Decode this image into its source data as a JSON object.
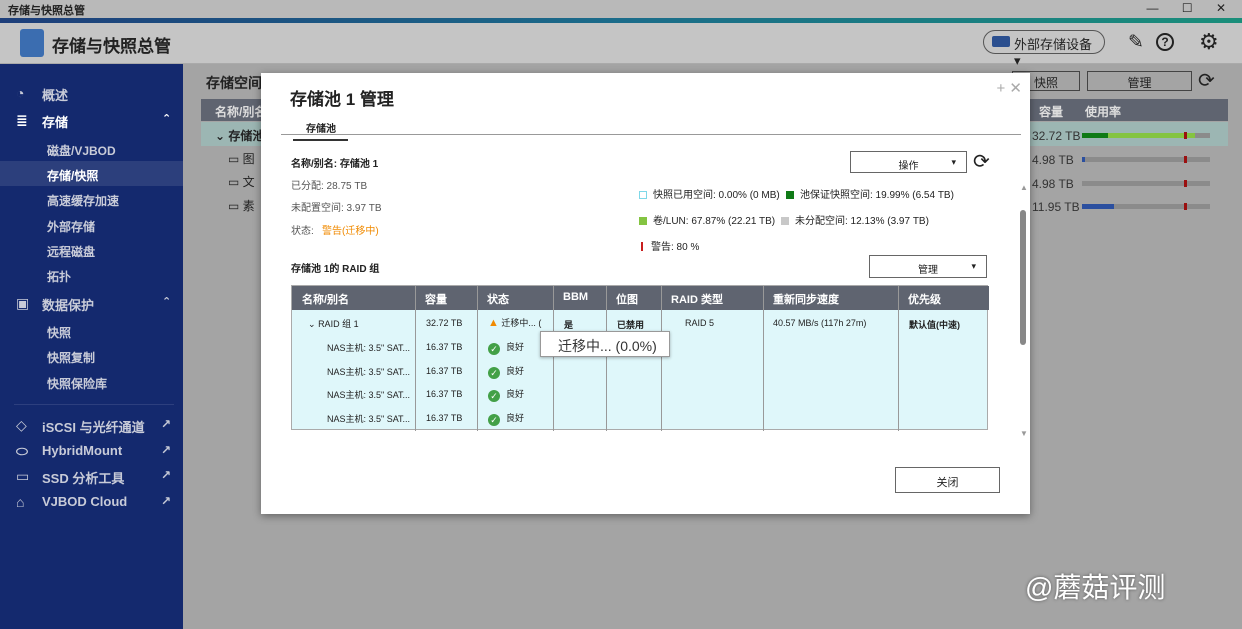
{
  "window": {
    "title": "存储与快照总管",
    "controls": "— ☐ ✕"
  },
  "header": {
    "app_title": "存储与快照总管",
    "external_storage": "外部存储设备",
    "external_caret": "▾",
    "wand_icon": "✎",
    "help_icon": "?",
    "settings_icon": "⚙"
  },
  "sidebar": {
    "overview": "概述",
    "storage": "存储",
    "storage_items": [
      "磁盘/VJBOD",
      "存储/快照",
      "高速缓存加速",
      "外部存储",
      "远程磁盘",
      "拓扑"
    ],
    "data_protection": "数据保护",
    "protection_items": [
      "快照",
      "快照复制",
      "快照保险库"
    ],
    "apps": [
      "iSCSI 与光纤通道",
      "HybridMount",
      "SSD 分析工具",
      "VJBOD Cloud"
    ],
    "collapse_icon": "⌃",
    "external_link_icon": "↗"
  },
  "background": {
    "page_title": "存储空间",
    "col_name": "名称/别名",
    "col_capacity": "容量",
    "col_usage": "使用率",
    "snapshot_btn": "快照",
    "manage_btn": "管理",
    "rows": [
      {
        "name": "存储池",
        "capacity": "32.72 TB",
        "usage_green_dark": 0.2,
        "usage_green": 0.88,
        "warn": 0.8
      },
      {
        "name": "图",
        "capacity": "4.98 TB",
        "usage_blue": 0.02,
        "warn": 0.8
      },
      {
        "name": "文",
        "capacity": "4.98 TB",
        "usage_blue": 0,
        "warn": 0.8
      },
      {
        "name": "素",
        "capacity": "11.95 TB",
        "usage_blue": 0.25,
        "warn": 0.8
      }
    ]
  },
  "modal": {
    "title": "存储池 1 管理",
    "tab": "存储池",
    "name_label": "名称/别名: 存储池 1",
    "allocated": "已分配:  28.75 TB",
    "unallocated": "未配置空间:   3.97 TB",
    "status_label": "状态:",
    "status_value": "警告(迁移中)",
    "action_btn": "操作",
    "legend": {
      "snapshot_used": "快照已用空间: 0.00% (0 MB)",
      "guaranteed": "池保证快照空间: 19.99% (6.54 TB)",
      "volume_lun": "卷/LUN: 67.87% (22.21 TB)",
      "unallocated": "未分配空间: 12.13% (3.97 TB)",
      "warning": "警告: 80 %"
    },
    "colors": {
      "snapshot_used": "#7fd8e8",
      "guaranteed": "#0f7a16",
      "volume_lun": "#84c441",
      "unallocated": "#c8c8c8",
      "warning": "#c81e1e",
      "status_warning": "#f08a00"
    },
    "raid_title": "存储池 1的 RAID 组",
    "manage_btn": "管理",
    "table": {
      "headers": [
        "名称/别名",
        "容量",
        "状态",
        "BBM",
        "位图",
        "RAID 类型",
        "重新同步速度",
        "优先级"
      ],
      "group": {
        "name": "RAID 组 1",
        "capacity": "32.72 TB",
        "status": "迁移中... (",
        "bbm": "是",
        "bitmap": "已禁用",
        "raid_type": "RAID 5",
        "resync": "40.57 MB/s (117h 27m)",
        "priority": "默认值(中速)"
      },
      "disks": [
        {
          "name": "NAS主机: 3.5\" SAT...",
          "capacity": "16.37 TB",
          "status": "良好"
        },
        {
          "name": "NAS主机: 3.5\" SAT...",
          "capacity": "16.37 TB",
          "status": "良好"
        },
        {
          "name": "NAS主机: 3.5\" SAT...",
          "capacity": "16.37 TB",
          "status": "良好"
        },
        {
          "name": "NAS主机: 3.5\" SAT...",
          "capacity": "16.37 TB",
          "status": "良好"
        }
      ]
    },
    "tooltip": "迁移中... (0.0%)",
    "close_btn": "关闭"
  },
  "watermark": "@蘑菇评测"
}
